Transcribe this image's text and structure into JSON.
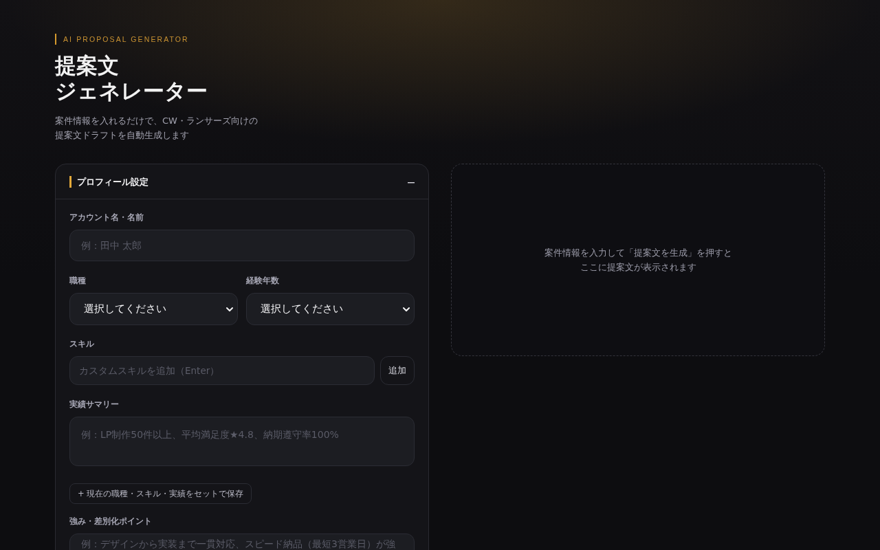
{
  "header": {
    "eyebrow": "AI PROPOSAL GENERATOR",
    "title_lines": [
      "提案文",
      "ジェネレーター"
    ],
    "subtitle_lines": [
      "案件情報を入れるだけで、CW・ランサーズ向けの",
      "提案文ドラフトを自動生成します"
    ]
  },
  "profile_panel": {
    "title": "プロフィール設定",
    "expanded": true,
    "fields": [
      {
        "kind": "text",
        "label": "アカウント名・名前",
        "placeholder": "例：田中 太郎"
      },
      {
        "kind": "select_row",
        "items": [
          {
            "label": "職種",
            "value": "選択してください"
          },
          {
            "label": "経験年数",
            "value": "選択してください"
          }
        ]
      },
      {
        "kind": "text_with_button",
        "label": "スキル",
        "placeholder": "カスタムスキルを追加（Enter）",
        "button": "追加"
      },
      {
        "kind": "textarea",
        "label": "実績サマリー",
        "placeholder": "例：LP制作50件以上、平均満足度★4.8、納期遵守率100%"
      },
      {
        "kind": "action",
        "button": "+ 現在の職種・スキル・実績をセットで保存"
      },
      {
        "kind": "textarea",
        "label": "強み・差別化ポイント",
        "placeholder": "例：デザインから実装まで一貫対応、スピード納品（最短3営業日）が強"
      }
    ]
  },
  "output_panel": {
    "message_lines": [
      "案件情報を入力して「提案文を生成」を押すと",
      "ここに提案文が表示されます"
    ]
  }
}
